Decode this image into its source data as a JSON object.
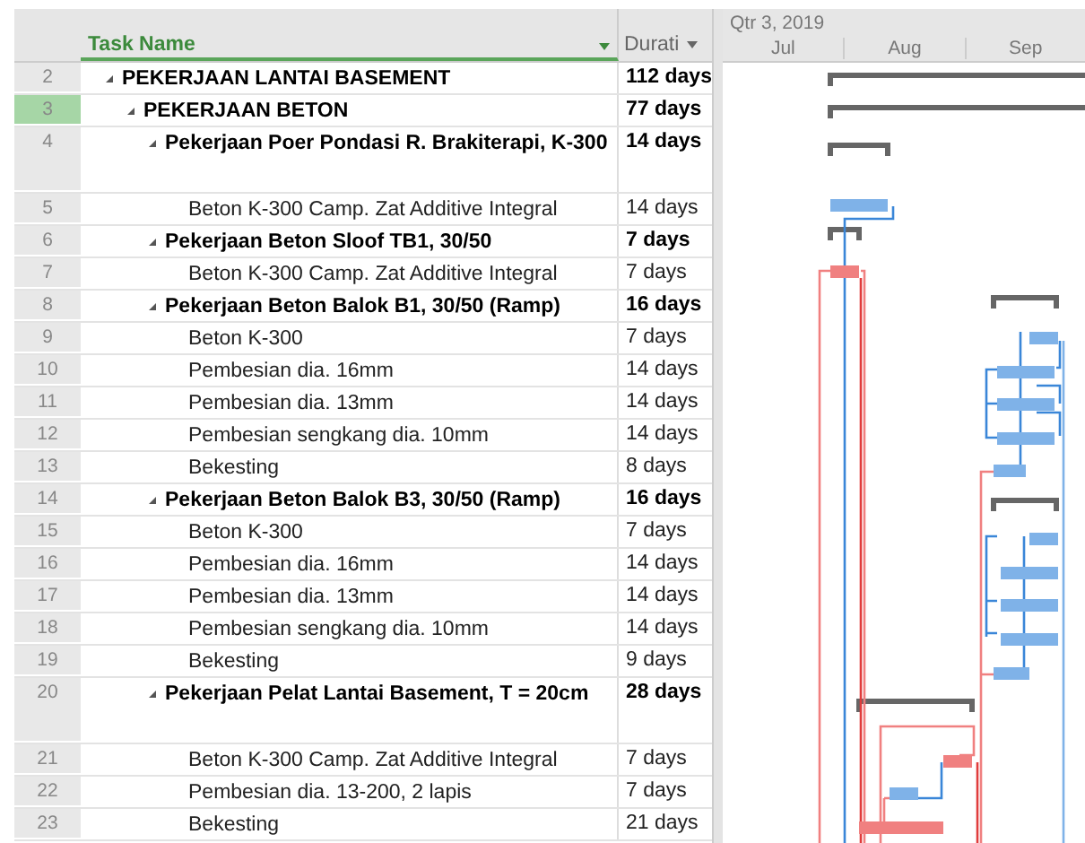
{
  "columns": {
    "task_name": "Task Name",
    "duration": "Durati"
  },
  "timescale": {
    "quarter": "Qtr 3, 2019",
    "months": [
      "Jul",
      "Aug",
      "Sep"
    ]
  },
  "tasks": [
    {
      "id": "2",
      "name": "PEKERJAAN LANTAI BASEMENT",
      "duration": "112 days",
      "selected": false,
      "expanded": true,
      "children": [
        {
          "id": "3",
          "name": "PEKERJAAN BETON",
          "duration": "77 days",
          "selected": true,
          "expanded": true,
          "children": [
            {
              "id": "4",
              "name": "Pekerjaan Poer Pondasi R. Brakiterapi, K-300",
              "duration": "14 days",
              "selected": false,
              "expanded": true,
              "children": [
                {
                  "id": "5",
                  "name": "Beton K-300 Camp. Zat Additive Integral",
                  "duration": "14 days",
                  "selected": false
                }
              ]
            },
            {
              "id": "6",
              "name": "Pekerjaan Beton Sloof TB1, 30/50",
              "duration": "7 days",
              "selected": false,
              "expanded": true,
              "children": [
                {
                  "id": "7",
                  "name": "Beton K-300 Camp. Zat Additive Integral",
                  "duration": "7 days",
                  "selected": false
                }
              ]
            },
            {
              "id": "8",
              "name": "Pekerjaan Beton Balok B1, 30/50 (Ramp)",
              "duration": "16 days",
              "selected": false,
              "expanded": true,
              "children": [
                {
                  "id": "9",
                  "name": "Beton K-300",
                  "duration": "7 days",
                  "selected": false
                },
                {
                  "id": "10",
                  "name": "Pembesian dia. 16mm",
                  "duration": "14 days",
                  "selected": false
                },
                {
                  "id": "11",
                  "name": "Pembesian dia. 13mm",
                  "duration": "14 days",
                  "selected": false
                },
                {
                  "id": "12",
                  "name": "Pembesian sengkang dia. 10mm",
                  "duration": "14 days",
                  "selected": false
                },
                {
                  "id": "13",
                  "name": "Bekesting",
                  "duration": "8 days",
                  "selected": false
                }
              ]
            },
            {
              "id": "14",
              "name": "Pekerjaan Beton Balok B3, 30/50 (Ramp)",
              "duration": "16 days",
              "selected": false,
              "expanded": true,
              "children": [
                {
                  "id": "15",
                  "name": "Beton K-300",
                  "duration": "7 days",
                  "selected": false
                },
                {
                  "id": "16",
                  "name": "Pembesian dia. 16mm",
                  "duration": "14 days",
                  "selected": false
                },
                {
                  "id": "17",
                  "name": "Pembesian dia. 13mm",
                  "duration": "14 days",
                  "selected": false
                },
                {
                  "id": "18",
                  "name": "Pembesian sengkang dia. 10mm",
                  "duration": "14 days",
                  "selected": false
                },
                {
                  "id": "19",
                  "name": "Bekesting",
                  "duration": "9 days",
                  "selected": false
                }
              ]
            },
            {
              "id": "20",
              "name": "Pekerjaan Pelat Lantai Basement,  T = 20cm",
              "duration": "28 days",
              "selected": false,
              "expanded": true,
              "children": [
                {
                  "id": "21",
                  "name": "Beton K-300 Camp. Zat Additive Integral",
                  "duration": "7 days",
                  "selected": false
                },
                {
                  "id": "22",
                  "name": "Pembesian dia. 13-200, 2 lapis",
                  "duration": "7 days",
                  "selected": false
                },
                {
                  "id": "23",
                  "name": "Bekesting",
                  "duration": "21 days",
                  "selected": false
                }
              ]
            }
          ]
        }
      ]
    }
  ]
}
